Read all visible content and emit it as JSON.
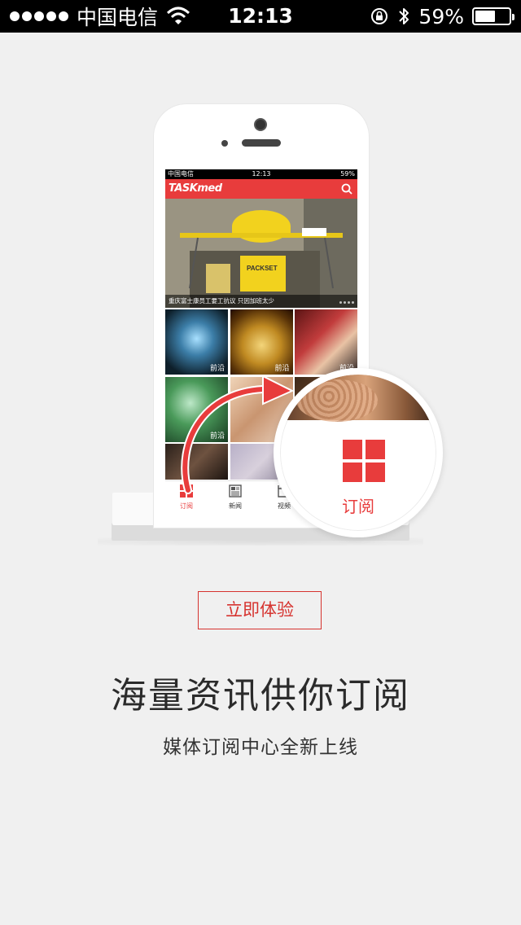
{
  "status_bar": {
    "carrier": "中国电信",
    "time": "12:13",
    "battery": "59%",
    "battery_level": 0.59,
    "signal_dots": 5
  },
  "phone_screen": {
    "status": {
      "carrier": "中国电信",
      "time": "12:13",
      "battery": "59%"
    },
    "logo": "TASKmed",
    "hero_caption": "重庆富士康员工要工抗议 只因加班太少",
    "tiles": [
      {
        "tag": "前沿"
      },
      {
        "tag": "前沿"
      },
      {
        "tag": "前沿"
      },
      {
        "tag": "前沿"
      },
      {
        "tag": ""
      },
      {
        "tag": ""
      },
      {
        "tag": ""
      },
      {
        "tag": ""
      },
      {
        "tag": ""
      }
    ],
    "tabs": [
      {
        "label": "订阅"
      },
      {
        "label": "新闻"
      },
      {
        "label": "视频"
      }
    ]
  },
  "bubble": {
    "label": "订阅"
  },
  "cta": {
    "label": "立即体验"
  },
  "headline": "海量资讯供你订阅",
  "subline": "媒体订阅中心全新上线",
  "colors": {
    "accent": "#e83c3c",
    "background": "#f0f0f0"
  }
}
